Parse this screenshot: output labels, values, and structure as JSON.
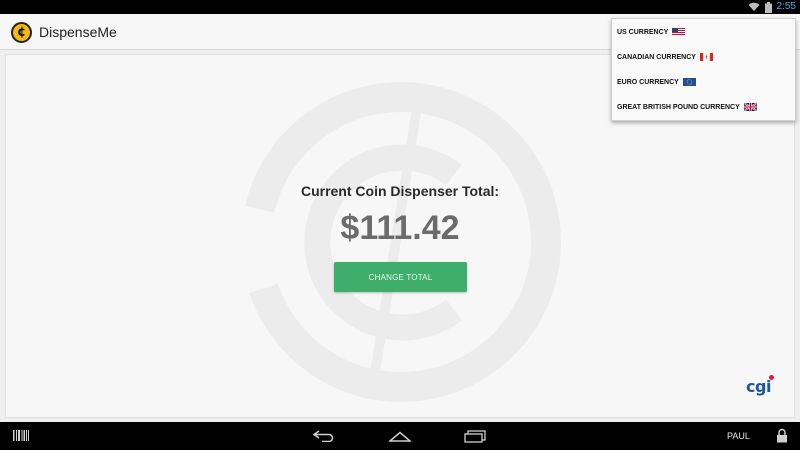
{
  "status_bar": {
    "time": "2:55",
    "icons": [
      "wifi-icon",
      "battery-icon"
    ]
  },
  "app": {
    "name": "DispenseMe",
    "logo_symbol": "¢"
  },
  "main": {
    "total_label": "Current Coin Dispenser Total:",
    "total_amount": "$111.42",
    "change_button_label": "CHANGE TOTAL"
  },
  "currency_menu": {
    "items": [
      {
        "label": "US CURRENCY",
        "flag": "us-flag-icon"
      },
      {
        "label": "CANADIAN CURRENCY",
        "flag": "canada-flag-icon"
      },
      {
        "label": "EURO CURRENCY",
        "flag": "eu-flag-icon"
      },
      {
        "label": "GREAT BRITISH POUND CURRENCY",
        "flag": "uk-flag-icon"
      }
    ]
  },
  "branding": {
    "logo_text": "cgi"
  },
  "nav_bar": {
    "user": "PAUL"
  },
  "colors": {
    "accent_green": "#3fae6c",
    "status_blue": "#33b5e5",
    "logo_yellow": "#f5b90f"
  }
}
